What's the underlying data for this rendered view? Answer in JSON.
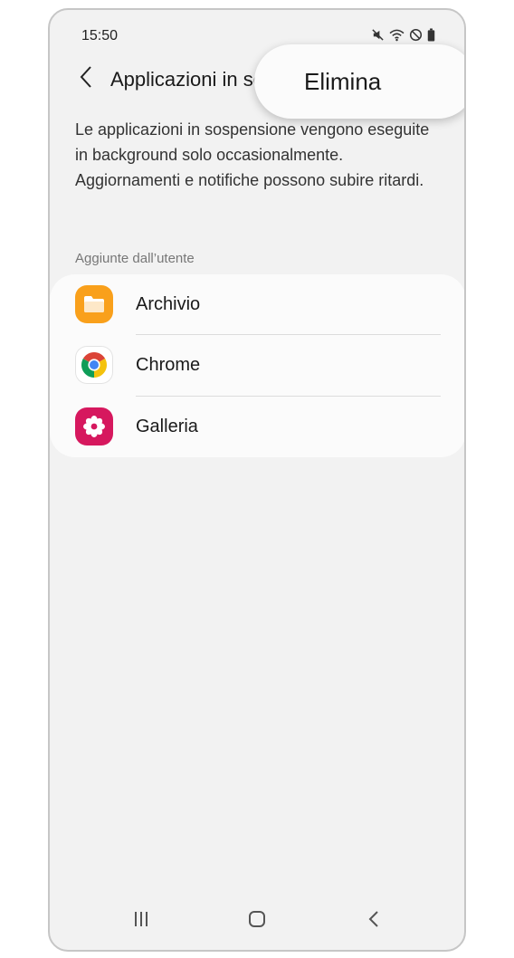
{
  "status_bar": {
    "time": "15:50",
    "icons": [
      "mute-icon",
      "wifi-icon",
      "do-not-disturb-icon",
      "battery-icon"
    ]
  },
  "header": {
    "title": "Applicazioni in sospensione",
    "back_icon": "chevron-left-icon"
  },
  "popup_menu": {
    "items": [
      {
        "label": "Elimina"
      }
    ]
  },
  "description": "Le applicazioni in sospensione vengono eseguite in background solo occasionalmente. Aggiornamenti e notifiche possono subire ritardi.",
  "section": {
    "header": "Aggiunte dall’utente",
    "apps": [
      {
        "label": "Archivio",
        "icon": "folder-icon",
        "color": "#f9a01b"
      },
      {
        "label": "Chrome",
        "icon": "chrome-icon",
        "color": "#ffffff"
      },
      {
        "label": "Galleria",
        "icon": "flower-icon",
        "color": "#d6185e"
      }
    ]
  },
  "navigation": {
    "buttons": [
      "recent-apps-icon",
      "home-icon",
      "back-icon"
    ]
  }
}
